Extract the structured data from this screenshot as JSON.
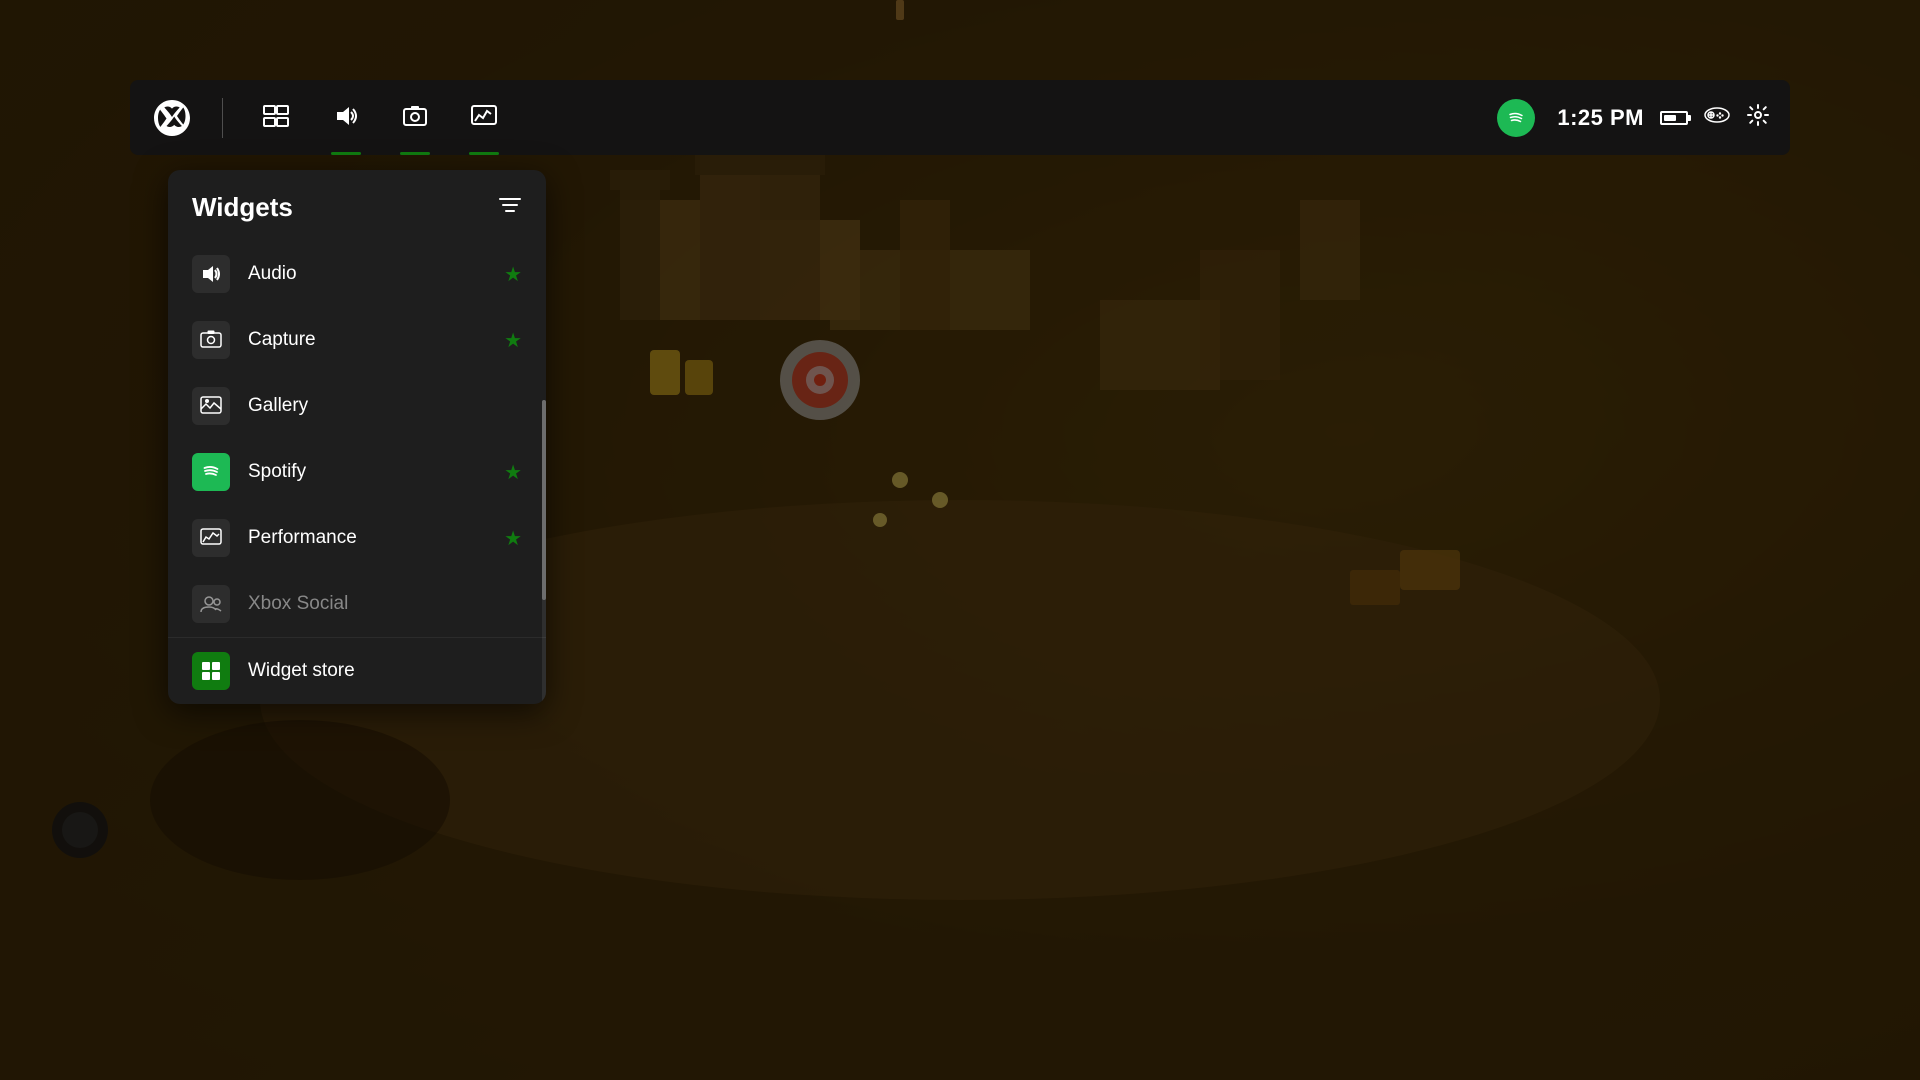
{
  "background": {
    "alt": "Strategy game aerial view with castle and soldiers"
  },
  "topbar": {
    "time": "1:25 PM",
    "nav_items": [
      {
        "id": "xbox",
        "label": "Xbox",
        "type": "logo"
      },
      {
        "id": "multitasking",
        "label": "Multitasking",
        "icon": "⊞",
        "active": false
      },
      {
        "id": "audio",
        "label": "Audio",
        "icon": "🔊",
        "active": true
      },
      {
        "id": "capture",
        "label": "Capture",
        "icon": "⏺",
        "active": true
      },
      {
        "id": "performance",
        "label": "Performance",
        "icon": "📊",
        "active": true
      },
      {
        "id": "spotify",
        "label": "Spotify",
        "type": "spotify",
        "active": false
      }
    ],
    "battery_icon": "battery",
    "controller_icon": "controller",
    "settings_icon": "settings"
  },
  "widgets_panel": {
    "title": "Widgets",
    "filter_icon": "filter",
    "items": [
      {
        "id": "audio",
        "name": "Audio",
        "icon": "volume",
        "icon_type": "default",
        "starred": true
      },
      {
        "id": "capture",
        "name": "Capture",
        "icon": "capture",
        "icon_type": "default",
        "starred": true
      },
      {
        "id": "gallery",
        "name": "Gallery",
        "icon": "gallery",
        "icon_type": "default",
        "starred": false
      },
      {
        "id": "spotify",
        "name": "Spotify",
        "icon": "spotify",
        "icon_type": "spotify",
        "starred": true
      },
      {
        "id": "performance",
        "name": "Performance",
        "icon": "performance",
        "icon_type": "default",
        "starred": true
      },
      {
        "id": "xbox-social",
        "name": "Xbox Social",
        "icon": "social",
        "icon_type": "dimmed",
        "starred": false
      }
    ],
    "store_item": {
      "id": "widget-store",
      "name": "Widget store",
      "icon": "store",
      "icon_type": "green"
    }
  }
}
